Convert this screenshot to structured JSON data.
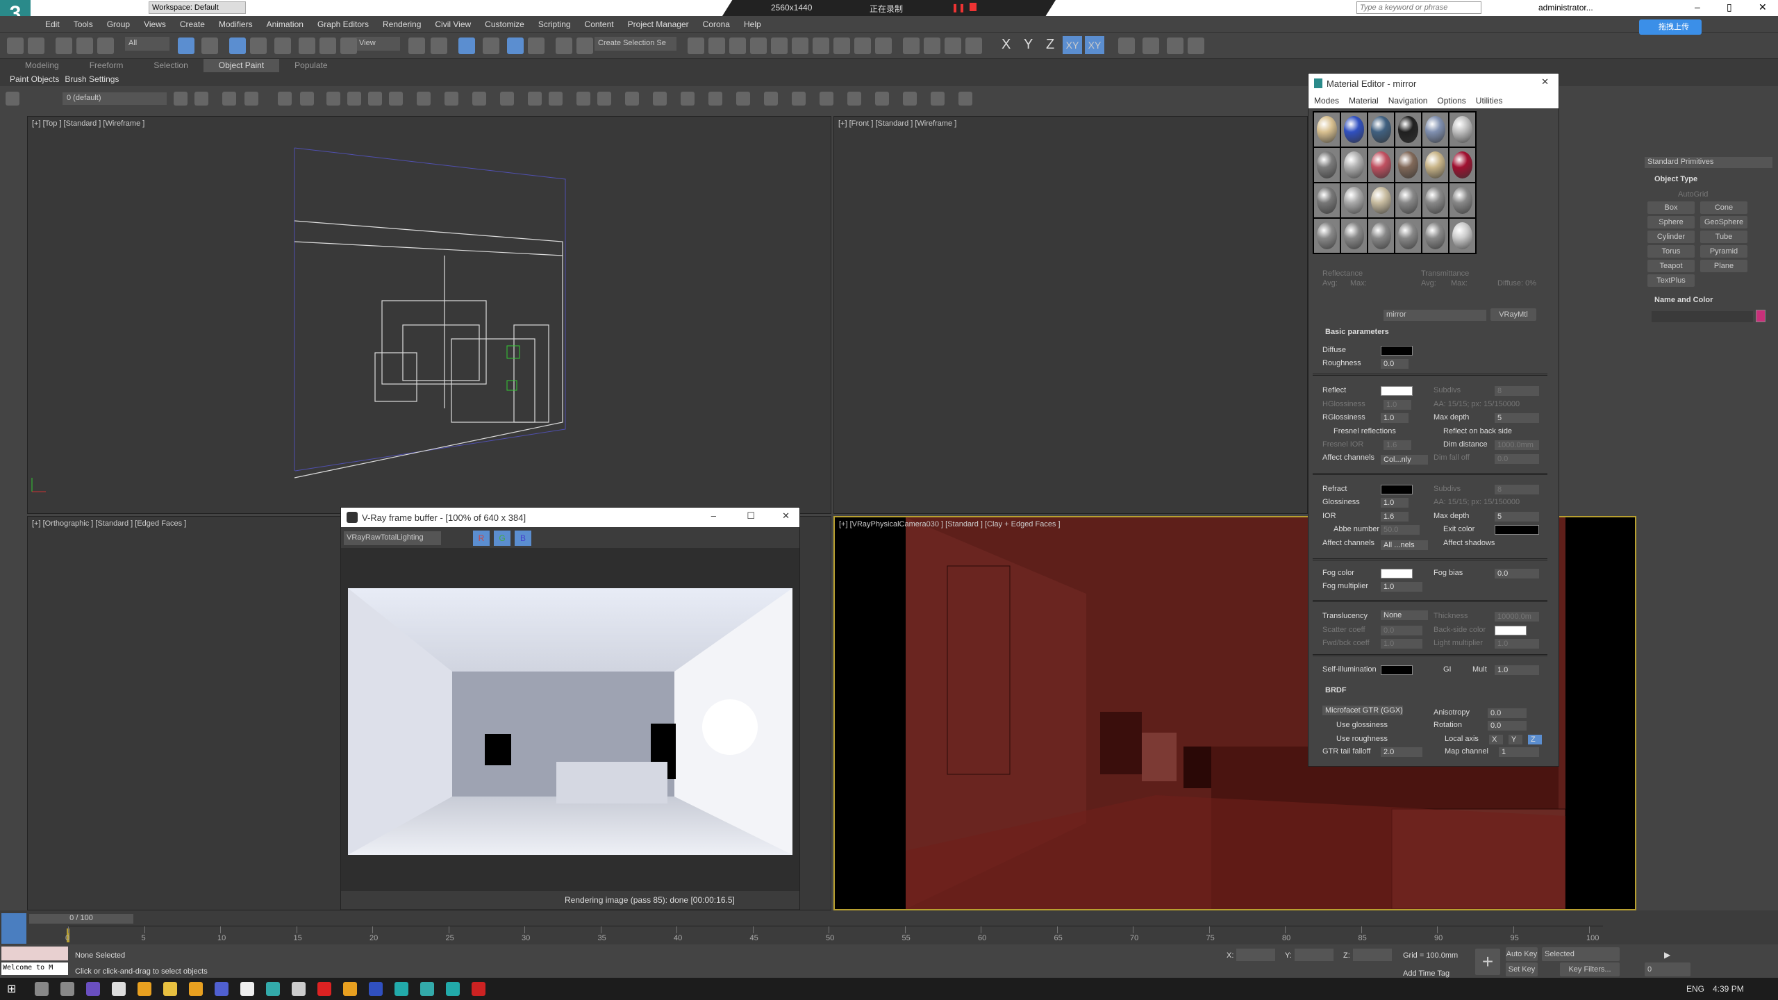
{
  "app": {
    "workspace": "Workspace: Default",
    "recorder_res": "2560x1440",
    "recorder_status": "正在录制",
    "search_placeholder": "Type a keyword or phrase",
    "user": "administrator...",
    "upload_btn": "拖拽上传"
  },
  "menu": [
    "Edit",
    "Tools",
    "Group",
    "Views",
    "Create",
    "Modifiers",
    "Animation",
    "Graph Editors",
    "Rendering",
    "Civil View",
    "Customize",
    "Scripting",
    "Content",
    "Project Manager",
    "Corona",
    "Help"
  ],
  "toolbar": {
    "filter": "All",
    "ref_coord": "View",
    "selection_set": "Create Selection Se",
    "axes": [
      "X",
      "Y",
      "Z",
      "XY",
      "XY"
    ]
  },
  "ribbon": {
    "tabs": [
      "Modeling",
      "Freeform",
      "Selection",
      "Object Paint",
      "Populate"
    ],
    "active": "Object Paint",
    "sub": [
      "Paint Objects",
      "Brush Settings"
    ]
  },
  "layer": {
    "name": "0 (default)"
  },
  "viewports": {
    "top": "[+] [Top ] [Standard ] [Wireframe ]",
    "front": "[+] [Front ] [Standard ] [Wireframe ]",
    "ortho": "[+] [Orthographic ] [Standard ] [Edged Faces ]",
    "camera": "[+] [VRayPhysicalCamera030 ] [Standard ] [Clay + Edged Faces ]"
  },
  "vfb": {
    "title": "V-Ray frame buffer - [100% of 640 x 384]",
    "channel": "VRayRawTotalLighting",
    "channels": [
      "R",
      "G",
      "B"
    ],
    "status": "Rendering image (pass 85): done [00:00:16.5]"
  },
  "mat": {
    "title": "Material Editor - mirror",
    "menu": [
      "Modes",
      "Material",
      "Navigation",
      "Options",
      "Utilities"
    ],
    "reflectance": "Reflectance",
    "transmittance": "Transmittance",
    "avg": "Avg:",
    "max": "Max:",
    "diffuse_pct": "Diffuse: 0%",
    "name": "mirror",
    "type": "VRayMtl",
    "basic": "Basic parameters",
    "diffuse": "Diffuse",
    "roughness": "Roughness",
    "roughness_v": "0.0",
    "reflect": "Reflect",
    "subdivs": "Subdivs",
    "subdivs_v": "8",
    "hgloss": "HGlossiness",
    "hgloss_v": "1.0",
    "aa": "AA: 15/15; px: 15/150000",
    "rgloss": "RGlossiness",
    "rgloss_v": "1.0",
    "maxdepth": "Max depth",
    "maxdepth_v": "5",
    "fresnel": "Fresnel reflections",
    "backside": "Reflect on back side",
    "fior": "Fresnel IOR",
    "fior_v": "1.6",
    "dimdist": "Dim distance",
    "dimdist_v": "1000.0mm",
    "affect": "Affect channels",
    "affect_v": "Col...nly",
    "dimfall": "Dim fall off",
    "dimfall_v": "0.0",
    "refract": "Refract",
    "gloss": "Glossiness",
    "gloss_v": "1.0",
    "ior": "IOR",
    "ior_v": "1.6",
    "abbe": "Abbe number",
    "abbe_v": "50.0",
    "exit": "Exit color",
    "affect2_v": "All ...nels",
    "shadows": "Affect shadows",
    "fogc": "Fog color",
    "fogbias": "Fog bias",
    "fogbias_v": "0.0",
    "fogm": "Fog multiplier",
    "fogm_v": "1.0",
    "transl": "Translucency",
    "transl_v": "None",
    "thick": "Thickness",
    "thick_v": "10000.0m",
    "scatter": "Scatter coeff",
    "scatter_v": "0.0",
    "backc": "Back-side color",
    "fwd": "Fwd/bck coeff",
    "fwd_v": "1.0",
    "lightm": "Light multiplier",
    "lightm_v": "1.0",
    "selfill": "Self-illumination",
    "gi": "GI",
    "mult": "Mult",
    "mult_v": "1.0",
    "brdf": "BRDF",
    "brdf_v": "Microfacet GTR (GGX)",
    "aniso": "Anisotropy",
    "aniso_v": "0.0",
    "rot": "Rotation",
    "rot_v": "0.0",
    "useg": "Use glossiness",
    "user": "Use roughness",
    "local": "Local axis",
    "ax": [
      "X",
      "Y",
      "Z"
    ],
    "gtr": "GTR tail falloff",
    "gtr_v": "2.0",
    "mapch": "Map channel",
    "mapch_v": "1"
  },
  "cmd": {
    "category": "Standard Primitives",
    "object_type": "Object Type",
    "autogrid": "AutoGrid",
    "buttons": [
      "Box",
      "Cone",
      "Sphere",
      "GeoSphere",
      "Cylinder",
      "Tube",
      "Torus",
      "Pyramid",
      "Teapot",
      "Plane",
      "TextPlus"
    ],
    "name_color": "Name and Color",
    "color": "#c8307a"
  },
  "timeline": {
    "frame": "0 / 100",
    "ticks": [
      0,
      5,
      10,
      15,
      20,
      25,
      30,
      35,
      40,
      45,
      50,
      55,
      60,
      65,
      70,
      75,
      80,
      85,
      90,
      95,
      100
    ]
  },
  "status": {
    "welcome": "Welcome to M",
    "selected": "None Selected",
    "prompt": "Click or click-and-drag to select objects",
    "x": "X:",
    "y": "Y:",
    "z": "Z:",
    "grid": "Grid = 100.0mm",
    "timetag": "Add Time Tag",
    "autokey": "Auto Key",
    "setkey": "Set Key",
    "keymode": "Selected",
    "keyfilters": "Key Filters...",
    "curframe": "0"
  },
  "tray": {
    "lang": "ENG",
    "time": "4:39 PM"
  }
}
